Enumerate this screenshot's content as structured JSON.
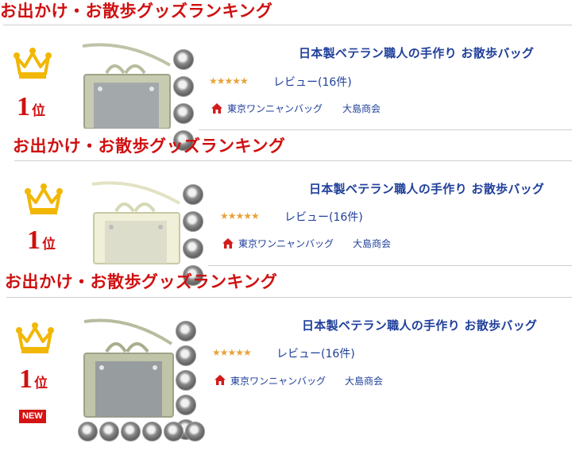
{
  "sections": [
    {
      "title": "お出かけ・お散歩グッズランキング",
      "rank_num": "1",
      "rank_suffix": "位",
      "product_name": "日本製ベテラン職人の手作り お散歩バッグ",
      "stars": "★★★★★",
      "review_text": "レビュー(16件)",
      "shop_name": "東京ワンニャンバッグ",
      "company": "大島商会"
    },
    {
      "title": "お出かけ・お散歩グッズランキング",
      "rank_num": "1",
      "rank_suffix": "位",
      "product_name": "日本製ベテラン職人の手作り お散歩バッグ",
      "stars": "★★★★★",
      "review_text": "レビュー(16件)",
      "shop_name": "東京ワンニャンバッグ",
      "company": "大島商会"
    },
    {
      "title": "お出かけ・お散歩グッズランキング",
      "rank_num": "1",
      "rank_suffix": "位",
      "product_name": "日本製ベテラン職人の手作り お散歩バッグ",
      "stars": "★★★★★",
      "review_text": "レビュー(16件)",
      "shop_name": "東京ワンニャンバッグ",
      "company": "大島商会",
      "badge": "NEW"
    }
  ],
  "icons": {
    "crown": "crown-icon",
    "home": "home-icon",
    "stars": "star-rating-icon"
  },
  "colors": {
    "title_red": "#d01010",
    "link_blue": "#1f3f9a",
    "crown_gold": "#f2b705",
    "star_orange": "#e8a33a",
    "badge_red": "#d41414"
  }
}
